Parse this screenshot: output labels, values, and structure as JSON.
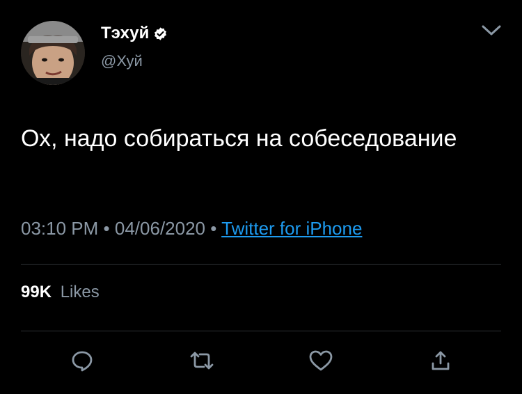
{
  "author": {
    "display_name": "Тэхуй",
    "handle": "@Хуй",
    "verified": true,
    "avatar_icon": "avatar"
  },
  "tweet": {
    "text": "Ох, надо собираться на собеседование",
    "time": "03:10 PM",
    "date": "04/06/2020",
    "separator": "•",
    "source": "Twitter for iPhone"
  },
  "stats": {
    "likes_count": "99K",
    "likes_label": "Likes"
  },
  "actions": {
    "reply_icon": "reply-icon",
    "retweet_icon": "retweet-icon",
    "like_icon": "heart-icon",
    "share_icon": "share-icon"
  },
  "colors": {
    "background": "#000000",
    "text": "#ffffff",
    "secondary": "#8b98a5",
    "link": "#1d9bf0",
    "divider": "#2f3336"
  }
}
